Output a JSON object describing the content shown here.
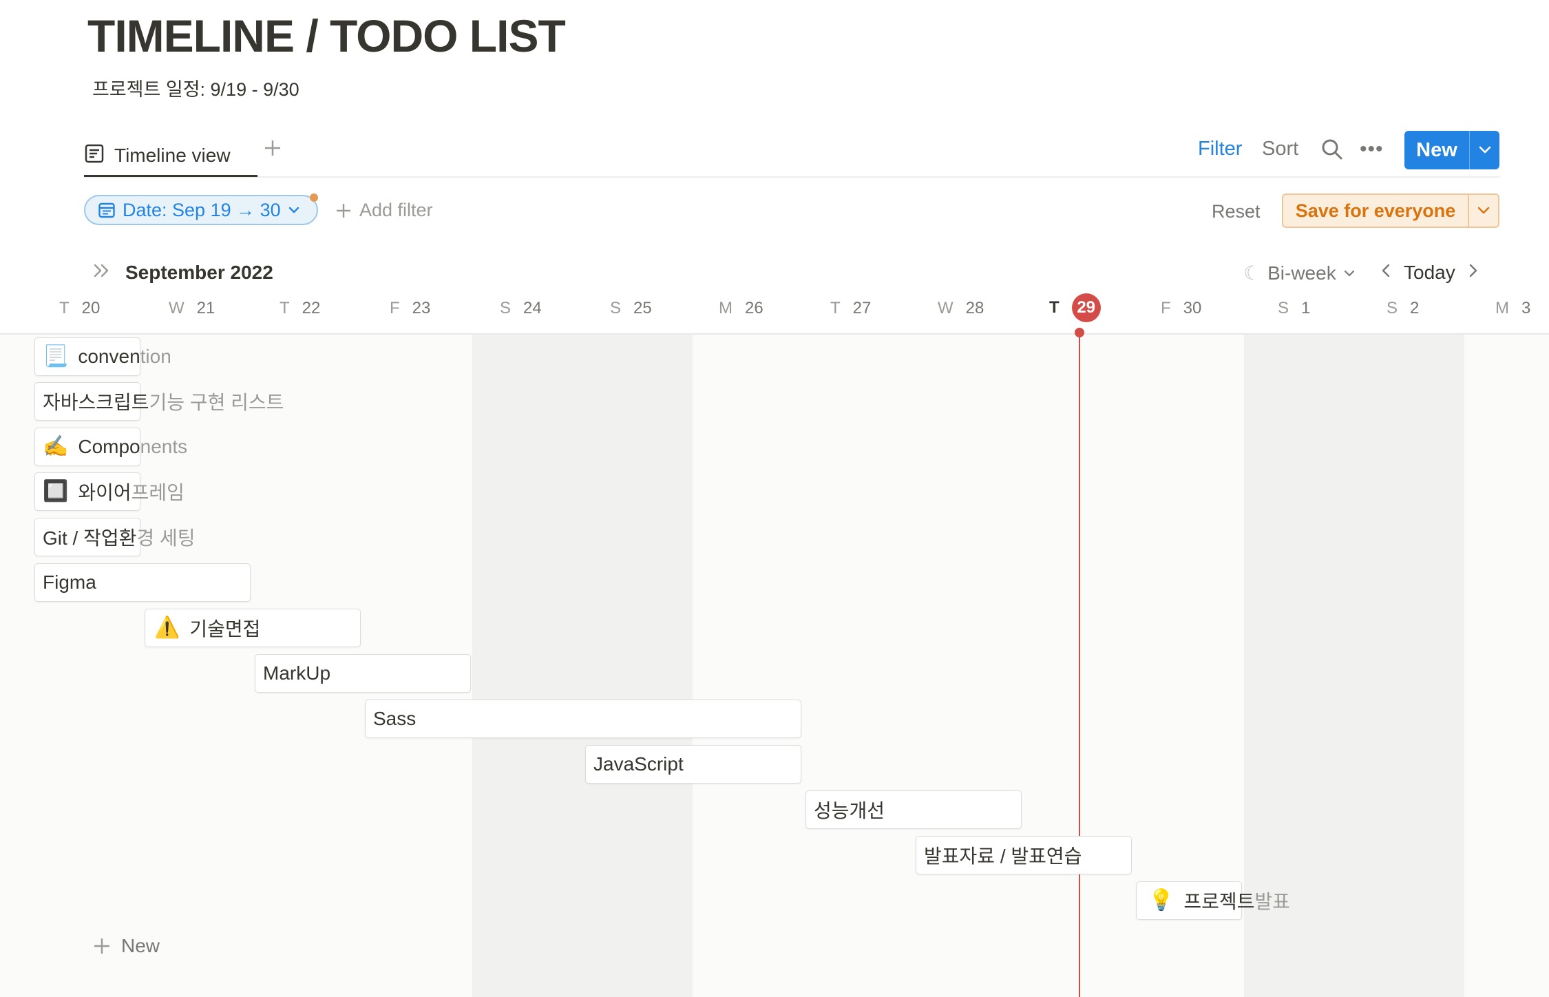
{
  "page": {
    "title": "TIMELINE / TODO LIST",
    "subtitle": "프로젝트 일정: 9/19 - 9/30"
  },
  "views": {
    "active_tab": "Timeline view",
    "add_view_icon": "plus-icon"
  },
  "toolbar": {
    "filter": "Filter",
    "sort": "Sort",
    "search_icon": "search-icon",
    "more_label": "•••",
    "new_label": "New"
  },
  "filters": {
    "date_chip": "Date: Sep 19 → 30",
    "add_filter": "Add filter",
    "reset": "Reset",
    "save": "Save for everyone"
  },
  "timeline": {
    "month": "September 2022",
    "range": "Bi-week",
    "today": "Today",
    "new_row": "New",
    "today_date": "29",
    "days": [
      {
        "dow": "T",
        "num": "20"
      },
      {
        "dow": "W",
        "num": "21"
      },
      {
        "dow": "T",
        "num": "22"
      },
      {
        "dow": "F",
        "num": "23"
      },
      {
        "dow": "S",
        "num": "24"
      },
      {
        "dow": "S",
        "num": "25"
      },
      {
        "dow": "M",
        "num": "26"
      },
      {
        "dow": "T",
        "num": "27"
      },
      {
        "dow": "W",
        "num": "28"
      },
      {
        "dow": "T",
        "num": "29"
      },
      {
        "dow": "F",
        "num": "30"
      },
      {
        "dow": "S",
        "num": "1"
      },
      {
        "dow": "S",
        "num": "2"
      },
      {
        "dow": "M",
        "num": "3"
      }
    ]
  },
  "tasks": [
    {
      "emoji": "📃",
      "inside": "conven",
      "outside": "tion"
    },
    {
      "emoji": "",
      "inside": "자바스크립트",
      "outside": " 기능 구현 리스트"
    },
    {
      "emoji": "✍️",
      "inside": "Compo",
      "outside": "nents"
    },
    {
      "emoji": "🔲",
      "inside": "와이어",
      "outside": "프레임"
    },
    {
      "emoji": "",
      "inside": "Git / 작업환",
      "outside": "경 세팅"
    },
    {
      "emoji": "",
      "inside": "Figma",
      "outside": ""
    },
    {
      "emoji": "⚠️",
      "inside": "기술면접",
      "outside": ""
    },
    {
      "emoji": "",
      "inside": "MarkUp",
      "outside": ""
    },
    {
      "emoji": "",
      "inside": "Sass",
      "outside": ""
    },
    {
      "emoji": "",
      "inside": "JavaScript",
      "outside": ""
    },
    {
      "emoji": "",
      "inside": "성능개선",
      "outside": ""
    },
    {
      "emoji": "",
      "inside": "발표자료 / 발표연습",
      "outside": ""
    },
    {
      "emoji": "💡",
      "inside": "프로젝트",
      "outside": " 발표"
    }
  ],
  "colors": {
    "accent_blue": "#2383e2",
    "today_red": "#d44c47",
    "save_orange": "#d9730d"
  }
}
